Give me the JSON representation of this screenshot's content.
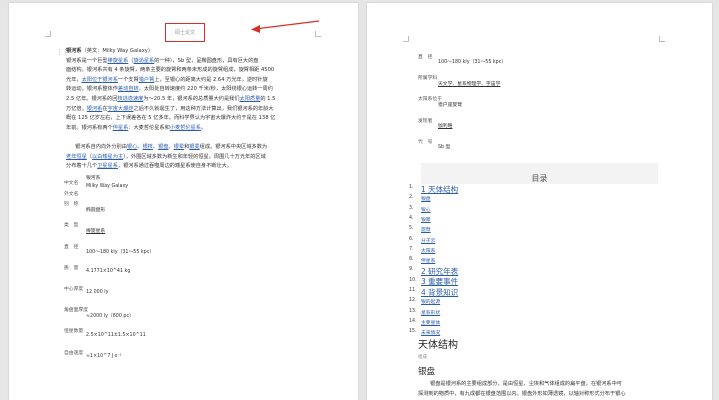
{
  "left_page": {
    "header": "硕士论文",
    "paragraph1": [
      {
        "parts": [
          [
            "bold",
            "银河系"
          ],
          [
            "text",
            "（英文：Milky Way Galaxy）"
          ]
        ]
      },
      {
        "parts": [
          [
            "text",
            "银河系是一个巨型"
          ],
          [
            "link",
            "棒旋星系"
          ],
          [
            "text",
            "（"
          ],
          [
            "link",
            "旋涡星系"
          ],
          [
            "text",
            "的一种），Sb 型，呈椭圆盘形，具有巨大的盘"
          ]
        ]
      },
      {
        "parts": [
          [
            "text",
            "面结构。银河系共有 4 条旋臂，两条主要的旋臂和两条未形成的旋臂组成，旋臂相距 4500"
          ]
        ]
      },
      {
        "parts": [
          [
            "text",
            "光年，"
          ],
          [
            "link",
            "太阳位于"
          ],
          [
            "link",
            "银河系"
          ],
          [
            "text",
            "一个支臂"
          ],
          [
            "link",
            "猎户臂"
          ],
          [
            "text",
            "上，至银心的距离大约是 2.64 万光年，逆时针旋"
          ]
        ]
      },
      {
        "parts": [
          [
            "text",
            "转运动，银河系整体作"
          ],
          [
            "link",
            "差动自转"
          ],
          [
            "text",
            "，太阳处自转速度约 220 千米/秒，太阳绕银心运转一周约"
          ]
        ]
      },
      {
        "parts": [
          [
            "text",
            "2.5 亿年。银河系的回"
          ],
          [
            "link",
            "核逃逸速度"
          ],
          [
            "text",
            "为～20.5 年，银河系的总质量大约是我们"
          ],
          [
            "link",
            "太阳质量"
          ],
          [
            "text",
            "的 1.5"
          ]
        ]
      },
      {
        "parts": [
          [
            "text",
            "万亿倍，"
          ],
          [
            "link",
            "银河系"
          ],
          [
            "text",
            "在"
          ],
          [
            "link",
            "宇宙大爆炸"
          ],
          [
            "text",
            "之后不久就诞生了，用这种方法计算出，我们银河系的年龄大"
          ]
        ]
      },
      {
        "parts": [
          [
            "text",
            "概在 125 亿岁左右，上下误差各在 5 亿多年。而科学界认为宇宙大爆炸大约于是在 138 亿"
          ]
        ]
      },
      {
        "parts": [
          [
            "text",
            "年前。银河系有两个"
          ],
          [
            "link",
            "伴星系"
          ],
          [
            "text",
            "：大麦哲伦星系和"
          ],
          [
            "link",
            "小麦哲伦星系"
          ],
          [
            "text",
            "。"
          ]
        ]
      }
    ],
    "paragraph2": [
      {
        "parts": [
          [
            "text",
            "银河系自内向外分别由"
          ],
          [
            "link",
            "银心"
          ],
          [
            "text",
            "、"
          ],
          [
            "link",
            "银核"
          ],
          [
            "text",
            "、"
          ],
          [
            "link",
            "银盘"
          ],
          [
            "text",
            "、"
          ],
          [
            "link",
            "银晕"
          ],
          [
            "text",
            "和"
          ],
          [
            "link",
            "银冕"
          ],
          [
            "text",
            "组成。银河系中央区域多数为"
          ]
        ]
      },
      {
        "parts": [
          [
            "link",
            "老年恒星"
          ],
          [
            "text",
            "（"
          ],
          [
            "link",
            "以白矮星为主"
          ],
          [
            "text",
            "），外围区域多数为新生和年轻的恒星。周围几十万光年的区域"
          ]
        ]
      },
      {
        "parts": [
          [
            "text",
            "分布着十几个"
          ],
          [
            "link",
            "卫星星系"
          ],
          [
            "text",
            "，银河系通过吞噬周边的矮星系使自身不断壮大。"
          ]
        ]
      }
    ],
    "fields": [
      {
        "label": "中文名",
        "value": "银河系",
        "link": false
      },
      {
        "label": "外文名",
        "value": "Milky Way Galaxy",
        "link": false
      },
      {
        "label": "别　称",
        "value": "",
        "link": false
      },
      {
        "label": "",
        "value": "椭圆盘形",
        "link": false
      },
      {
        "label": "类　型",
        "value": "",
        "link": false
      },
      {
        "label": "",
        "value": "棒旋星系",
        "link": true
      },
      {
        "label": "直　径",
        "value": "",
        "link": false
      },
      {
        "label": "",
        "value": "100～180 kly（31～55 kpc）",
        "link": false
      },
      {
        "label": "质　量",
        "value": "",
        "link": false
      },
      {
        "label": "",
        "value": "4.1771×10^41 kg",
        "link": false
      },
      {
        "label": "中心厚度",
        "value": "",
        "link": false
      },
      {
        "label": "",
        "value": "12 000 ly",
        "link": false
      },
      {
        "label": "角盘面厚度",
        "value": "",
        "link": false
      },
      {
        "label": "",
        "value": "≈2000 ly（600 pc）",
        "link": false
      },
      {
        "label": "恒星数量",
        "value": "",
        "link": false
      },
      {
        "label": "",
        "value": "2.5×10^11±1.5×10^11",
        "link": false
      },
      {
        "label": "自由速度",
        "value": "",
        "link": false
      },
      {
        "label": "",
        "value": "≈1×10^7 J·s⁻¹",
        "link": false
      }
    ]
  },
  "right_page": {
    "fields": [
      {
        "label": "直　径",
        "value": "",
        "link": false
      },
      {
        "label": "",
        "value": "100～180 kly（31～55 kpc）",
        "link": false
      },
      {
        "label": "所属学科",
        "value": "",
        "link": false
      },
      {
        "label": "",
        "value": "天文学、星系物理学、宇宙学",
        "link": true
      },
      {
        "label": "太阳系位于",
        "value": "",
        "link": false
      },
      {
        "label": "",
        "value": "猎户座旋臂",
        "link": false
      },
      {
        "label": "发现者",
        "value": "",
        "link": false
      },
      {
        "label": "",
        "value": "伽利略",
        "link": true
      },
      {
        "label": "代　号",
        "value": "",
        "link": false
      },
      {
        "label": "",
        "value": "Sb 型",
        "link": false
      }
    ],
    "toc_title": "目录",
    "toc": [
      {
        "num": "1.",
        "label": "1 天体结构",
        "level": 1
      },
      {
        "num": "2.",
        "label": "银盘",
        "level": 2
      },
      {
        "num": "3.",
        "label": "银心",
        "level": 2
      },
      {
        "num": "4.",
        "label": "银晕",
        "level": 2
      },
      {
        "num": "5.",
        "label": "旋臂",
        "level": 2
      },
      {
        "num": "6.",
        "label": "分子云",
        "level": 2
      },
      {
        "num": "7.",
        "label": "太阳系",
        "level": 2
      },
      {
        "num": "8.",
        "label": "伴星系",
        "level": 2
      },
      {
        "num": "9.",
        "label": "2 研究年表",
        "level": 1
      },
      {
        "num": "10.",
        "label": "3 重要事件",
        "level": 1
      },
      {
        "num": "11.",
        "label": "4 背景知识",
        "level": 1
      },
      {
        "num": "12.",
        "label": "银的起源",
        "level": 2
      },
      {
        "num": "13.",
        "label": "星系形状",
        "level": 2
      },
      {
        "num": "14.",
        "label": "主要星体",
        "level": 2
      },
      {
        "num": "15.",
        "label": "未来情况",
        "level": 2
      }
    ],
    "heading1": "天体结构",
    "sub_label": "组成",
    "heading2": "银盘",
    "body_lines": [
      "银盘是银河系的主要组成部分，是由恒星、尘埃和气体组成的扁平盘，在银河系中可",
      "探测到的物质中，有九成都在银盘范围以内。银盘外形如薄透镜，以轴对称形式分布于银心"
    ]
  }
}
